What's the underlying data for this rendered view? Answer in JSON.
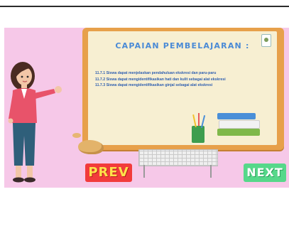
{
  "slide": {
    "title": "CAPAIAN PEMBELAJARAN :",
    "outcomes": [
      "11.7.1 Siswa dapat menjelaskan pendahuluan ekskresi dan paru-paru",
      "11.7.2 Siswa dapat mengidentifikasikan hati dan kulit sebagai alat ekskresi",
      "11.7.3 Siswa dapat mengidentifikasikan ginjal sebagai alat ekskresi"
    ]
  },
  "nav": {
    "prev_label": "PREV",
    "next_label": "NEXT"
  },
  "colors": {
    "background": "#f6c8e8",
    "board": "#f7efd2",
    "board_frame": "#e7a04b",
    "title": "#4a8ad6",
    "prev_button": "#f23b3b",
    "next_button": "#56d88a"
  },
  "icons": {
    "board_badge": "school-logo-icon"
  }
}
